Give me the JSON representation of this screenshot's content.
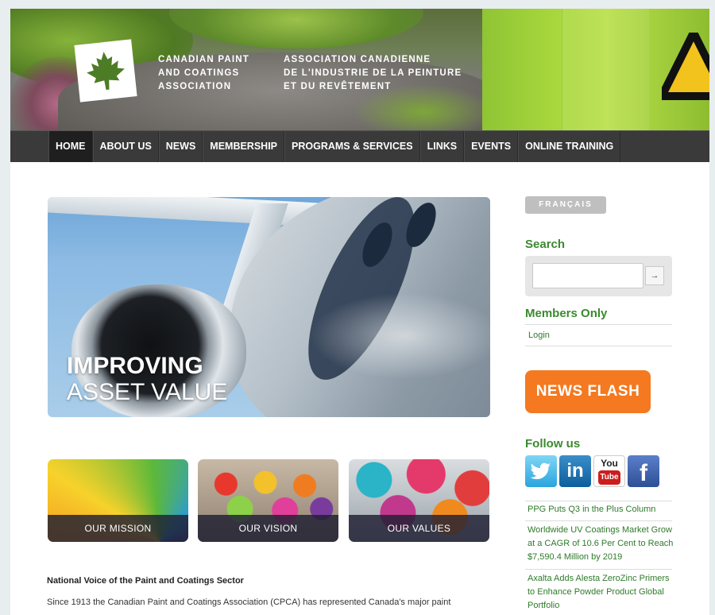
{
  "header": {
    "association_en": [
      "Canadian Paint",
      "and Coatings",
      "Association"
    ],
    "association_fr": [
      "Association canadienne",
      "de l'industrie de la peinture",
      "et du revêtement"
    ]
  },
  "nav": {
    "items": [
      "HOME",
      "ABOUT US",
      "NEWS",
      "MEMBERSHIP",
      "PROGRAMS & SERVICES",
      "LINKS",
      "EVENTS",
      "ONLINE TRAINING"
    ],
    "active": "HOME"
  },
  "hero": {
    "line1": "IMPROVING",
    "line2": "ASSET VALUE"
  },
  "tiles": [
    {
      "label": "OUR MISSION"
    },
    {
      "label": "OUR VISION"
    },
    {
      "label": "OUR VALUES"
    }
  ],
  "content": {
    "heading": "National Voice of the Paint and Coatings Sector",
    "intro": "Since 1913 the Canadian Paint and Coatings Association (CPCA) has represented Canada's major paint"
  },
  "sidebar": {
    "language_button": "FRANÇAIS",
    "search_heading": "Search",
    "search_button": "→",
    "members_heading": "Members Only",
    "login_link": "Login",
    "news_flash": "NEWS FLASH",
    "follow_heading": "Follow us",
    "news_items": [
      "PPG Puts Q3 in the Plus Column",
      "Worldwide UV Coatings Market Grow at a CAGR of 10.6 Per Cent to Reach $7,590.4 Million by 2019",
      "Axalta Adds Alesta ZeroZinc Primers to Enhance Powder Product Global Portfolio"
    ]
  },
  "social": {
    "linkedin": "in",
    "youtube_top": "You",
    "youtube_bottom": "Tube",
    "facebook": "f"
  },
  "colors": {
    "nav_bg": "#3a3a3a",
    "accent_green": "#3b8a2e",
    "news_flash_orange": "#f47920"
  }
}
